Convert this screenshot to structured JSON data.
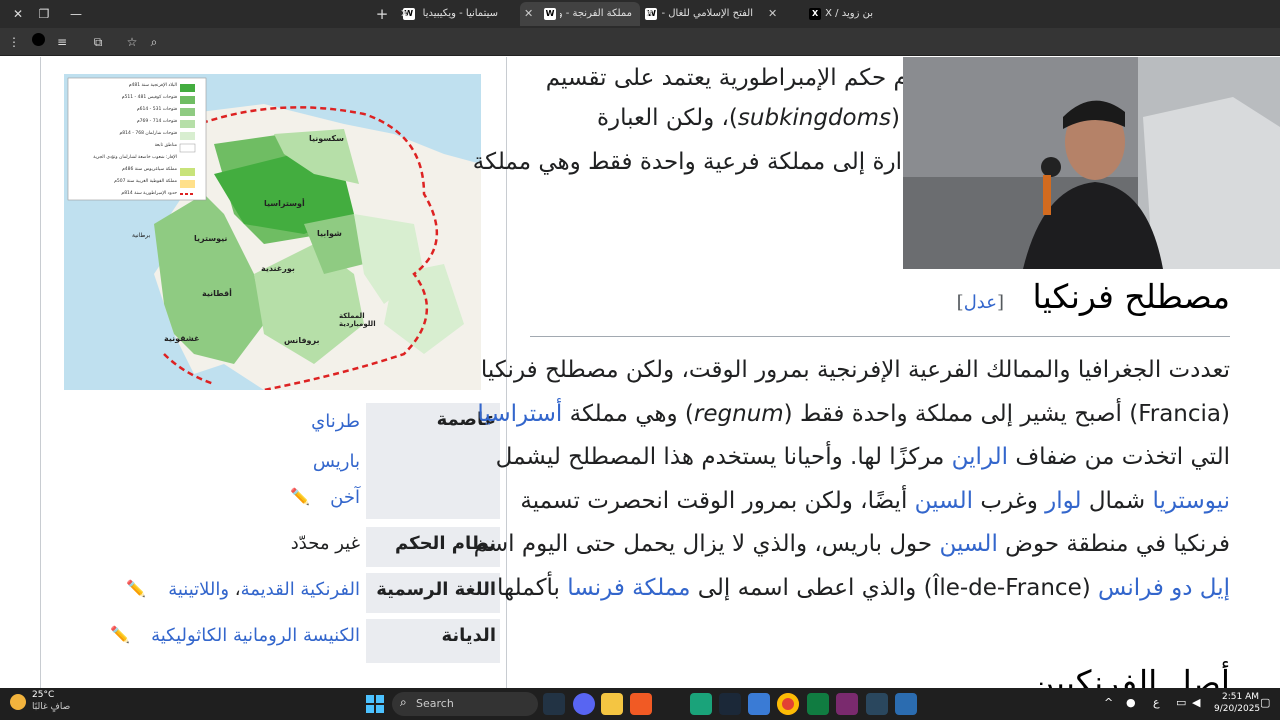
{
  "browser": {
    "tabs": [
      {
        "title": "بن زويد / X",
        "favicon": "X",
        "active": false
      },
      {
        "title": "الفتح الإسلامي للغال -",
        "favicon": "W",
        "active": false
      },
      {
        "title": "مملكة الفرنجة - ويكيب",
        "favicon": "W",
        "active": true
      },
      {
        "title": "سيتمانيا - ويكيبيديا",
        "favicon": "W",
        "active": false
      }
    ],
    "new_tab": "+",
    "minimize": "—",
    "maximize": "❐",
    "close": "✕"
  },
  "infobox": {
    "capital_label": "عاصمة",
    "capital_values": [
      "طرناي",
      "باريس",
      "آخن"
    ],
    "government_label": "نظام الحكم",
    "government_value": "غير محدّد",
    "language_label": "اللغة الرسمية",
    "language_value_1": "الفرنكية القديمة",
    "language_sep": "، ",
    "language_value_2": "واللاتينية",
    "religion_label": "الديانة",
    "religion_value": "الكنيسة الرومانية الكاثوليكية",
    "edit_icon": "✏️"
  },
  "map": {
    "legend": [
      "البلاد الإفرنجية سنة 481م",
      "فتوحات كوفيس 481 - 511م",
      "فتوحات 531 - 614م",
      "فتوحات 714 - 769م",
      "فتوحات شارلمان 768 - 814م",
      "مناطق تابعة",
      "الإفار: شعوب خاضعة لشارلمان وتؤدي الجزية",
      "مملكة سياغريوس سنة 486م",
      "مملكة القوطية الغربية سنة 507م",
      "حدود الإمبراطورية سنة 814م"
    ],
    "labels": [
      "سكسونيا",
      "أوستراسيا",
      "نيوستريا",
      "أقطانية",
      "شوابيا",
      "بورغندية",
      "بروفانس",
      "غشقونية",
      "المملكة اللومباردية",
      "برطانية"
    ]
  },
  "article": {
    "intro_line_1": "نظام حكم الإمبراطورية يعتمد على تقسيم",
    "intro_line_2_a": "(",
    "intro_line_2_term": "subkingdoms",
    "intro_line_2_b": ")، ولكن العبارة",
    "intro_line_3": "ارة إلى مملكة فرعية واحدة فقط وهي مملكة",
    "section_heading": "مصطلح فرنكيا",
    "edit_label": "عدل",
    "para": [
      {
        "parts": [
          {
            "t": "تعددت الجغرافيا والممالك الفرعية الإفرنجية بمرور الوقت، ولكن مصطلح فرنكيا",
            "link": false
          }
        ]
      },
      {
        "parts": [
          {
            "t": "(",
            "link": false
          },
          {
            "t": "Francia",
            "link": false
          },
          {
            "t": ") أصبح يشير إلى مملكة واحدة فقط (",
            "link": false
          },
          {
            "t": "regnum",
            "link": false,
            "italic": true
          },
          {
            "t": ") وهي مملكة ",
            "link": false
          },
          {
            "t": "أستراسيا",
            "link": true
          }
        ]
      },
      {
        "parts": [
          {
            "t": "التي اتخذت من ضفاف ",
            "link": false
          },
          {
            "t": "الراين",
            "link": true
          },
          {
            "t": " مركزًا لها. وأحيانا يستخدم هذا المصطلح ليشمل",
            "link": false
          }
        ]
      },
      {
        "parts": [
          {
            "t": "نيوستريا",
            "link": true
          },
          {
            "t": " شمال ",
            "link": false
          },
          {
            "t": "لوار",
            "link": true
          },
          {
            "t": " وغرب ",
            "link": false
          },
          {
            "t": "السين",
            "link": true
          },
          {
            "t": " أيضًا، ولكن بمرور الوقت انحصرت تسمية",
            "link": false
          }
        ]
      },
      {
        "parts": [
          {
            "t": "فرنكيا في منطقة حوض ",
            "link": false
          },
          {
            "t": "السين",
            "link": true
          },
          {
            "t": " حول باريس، والذي لا يزال يحمل حتى اليوم اسم",
            "link": false
          }
        ]
      },
      {
        "parts": [
          {
            "t": "إيل دو فرانس",
            "link": true
          },
          {
            "t": " (Île-de-France) والذي اعطى اسمه إلى ",
            "link": false
          },
          {
            "t": "مملكة فرنسا",
            "link": true
          },
          {
            "t": " بأكملها.",
            "link": false
          }
        ]
      }
    ],
    "next_heading": "أصل الفرنكيين"
  },
  "taskbar": {
    "weather_temp": "25°C",
    "weather_desc": "صافٍ غالبًا",
    "search_placeholder": "Search",
    "time": "2:51 AM",
    "date": "9/20/2025",
    "lang": "ع"
  },
  "colors": {
    "link": "#3366cc",
    "text": "#202122",
    "tab_bg": "#2b2b2b",
    "taskbar_bg": "#1f1f1f"
  }
}
